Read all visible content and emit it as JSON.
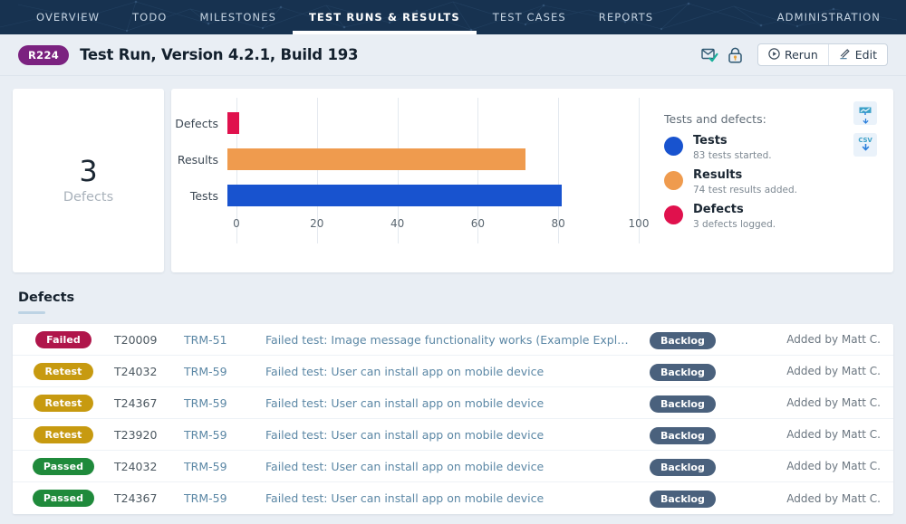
{
  "topnav": {
    "items": [
      {
        "label": "OVERVIEW",
        "active": false
      },
      {
        "label": "TODO",
        "active": false
      },
      {
        "label": "MILESTONES",
        "active": false
      },
      {
        "label": "TEST RUNS & RESULTS",
        "active": true
      },
      {
        "label": "TEST CASES",
        "active": false
      },
      {
        "label": "REPORTS",
        "active": false
      }
    ],
    "right_item": "ADMINISTRATION"
  },
  "header": {
    "run_badge": "R224",
    "title": "Test Run, Version 4.2.1, Build 193",
    "subscribe_icon": "envelope-check-icon",
    "lock_icon": "lock-icon",
    "rerun_label": "Rerun",
    "rerun_icon": "play-circle-icon",
    "edit_label": "Edit",
    "edit_icon": "pencil-icon"
  },
  "summary": {
    "value": "3",
    "label": "Defects"
  },
  "chart_data": {
    "type": "bar",
    "orientation": "horizontal",
    "title": "",
    "categories": [
      "Defects",
      "Results",
      "Tests"
    ],
    "values": [
      3,
      74,
      83
    ],
    "colors": [
      "#e0114d",
      "#ef9b4e",
      "#1853cf"
    ],
    "xlabel": "",
    "ylabel": "",
    "xlim": [
      0,
      100
    ],
    "xticks": [
      0,
      20,
      40,
      60,
      80,
      100
    ],
    "grid": true,
    "legend_position": "right"
  },
  "legend": {
    "title": "Tests and defects:",
    "items": [
      {
        "name": "Tests",
        "desc": "83 tests started.",
        "color": "#1853cf"
      },
      {
        "name": "Results",
        "desc": "74 test results added.",
        "color": "#ef9b4e"
      },
      {
        "name": "Defects",
        "desc": "3 defects logged.",
        "color": "#e0114d"
      }
    ],
    "download_image_icon": "chart-download-icon",
    "download_csv_label": "CSV",
    "download_csv_icon": "csv-download-icon"
  },
  "defects": {
    "section_title": "Defects",
    "rows": [
      {
        "status": "Failed",
        "status_color": "#b0164b",
        "test_id": "T20009",
        "reference": "TRM-51",
        "description": "Failed test: Image message functionality works (Example Expl…",
        "state": "Backlog",
        "author": "Added by Matt C."
      },
      {
        "status": "Retest",
        "status_color": "#c79a10",
        "test_id": "T24032",
        "reference": "TRM-59",
        "description": "Failed test: User can install app on mobile device",
        "state": "Backlog",
        "author": "Added by Matt C."
      },
      {
        "status": "Retest",
        "status_color": "#c79a10",
        "test_id": "T24367",
        "reference": "TRM-59",
        "description": "Failed test: User can install app on mobile device",
        "state": "Backlog",
        "author": "Added by Matt C."
      },
      {
        "status": "Retest",
        "status_color": "#c79a10",
        "test_id": "T23920",
        "reference": "TRM-59",
        "description": "Failed test: User can install app on mobile device",
        "state": "Backlog",
        "author": "Added by Matt C."
      },
      {
        "status": "Passed",
        "status_color": "#1f8a3b",
        "test_id": "T24032",
        "reference": "TRM-59",
        "description": "Failed test: User can install app on mobile device",
        "state": "Backlog",
        "author": "Added by Matt C."
      },
      {
        "status": "Passed",
        "status_color": "#1f8a3b",
        "test_id": "T24367",
        "reference": "TRM-59",
        "description": "Failed test: User can install app on mobile device",
        "state": "Backlog",
        "author": "Added by Matt C."
      }
    ]
  }
}
